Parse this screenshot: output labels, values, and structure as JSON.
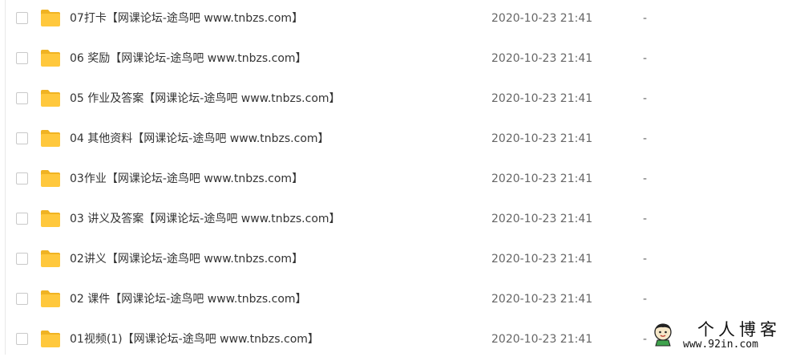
{
  "files": [
    {
      "name": "07打卡【网课论坛-途鸟吧 www.tnbzs.com】",
      "modified": "2020-10-23 21:41",
      "size": "-"
    },
    {
      "name": "06 奖励【网课论坛-途鸟吧 www.tnbzs.com】",
      "modified": "2020-10-23 21:41",
      "size": "-"
    },
    {
      "name": "05 作业及答案【网课论坛-途鸟吧 www.tnbzs.com】",
      "modified": "2020-10-23 21:41",
      "size": "-"
    },
    {
      "name": "04 其他资料【网课论坛-途鸟吧 www.tnbzs.com】",
      "modified": "2020-10-23 21:41",
      "size": "-"
    },
    {
      "name": "03作业【网课论坛-途鸟吧 www.tnbzs.com】",
      "modified": "2020-10-23 21:41",
      "size": "-"
    },
    {
      "name": "03 讲义及答案【网课论坛-途鸟吧 www.tnbzs.com】",
      "modified": "2020-10-23 21:41",
      "size": "-"
    },
    {
      "name": "02讲义【网课论坛-途鸟吧 www.tnbzs.com】",
      "modified": "2020-10-23 21:41",
      "size": "-"
    },
    {
      "name": "02 课件【网课论坛-途鸟吧 www.tnbzs.com】",
      "modified": "2020-10-23 21:41",
      "size": "-"
    },
    {
      "name": "01视频(1)【网课论坛-途鸟吧 www.tnbzs.com】",
      "modified": "2020-10-23 21:41",
      "size": "-"
    }
  ],
  "icons": {
    "row_icon": "folder-icon",
    "watermark_icon": "cartoon-avatar-icon"
  },
  "colors": {
    "folder": "#ffc83d",
    "folder_tab": "#f0b323",
    "text": "#333333",
    "meta_text": "#666666"
  },
  "watermark": {
    "title": "个人博客",
    "url": "www.92in.com"
  }
}
